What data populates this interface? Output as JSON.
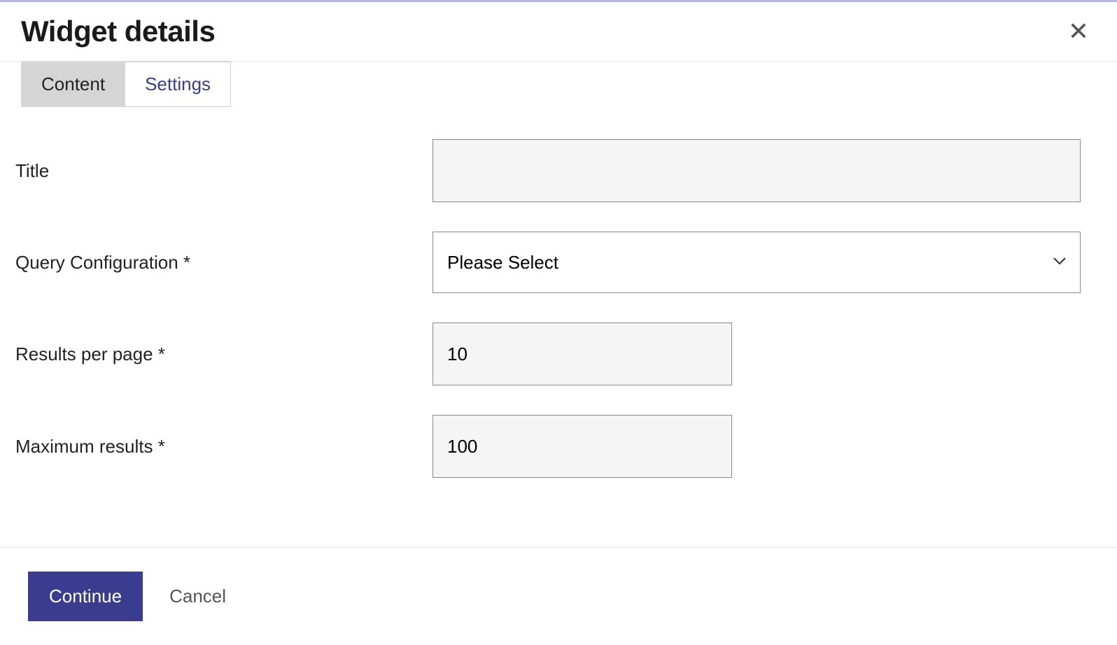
{
  "header": {
    "title": "Widget details"
  },
  "tabs": {
    "content": "Content",
    "settings": "Settings"
  },
  "form": {
    "title": {
      "label": "Title",
      "value": ""
    },
    "query_config": {
      "label": "Query Configuration *",
      "selected": "Please Select"
    },
    "results_per_page": {
      "label": "Results per page *",
      "value": "10"
    },
    "maximum_results": {
      "label": "Maximum results *",
      "value": "100"
    }
  },
  "footer": {
    "continue": "Continue",
    "cancel": "Cancel"
  }
}
